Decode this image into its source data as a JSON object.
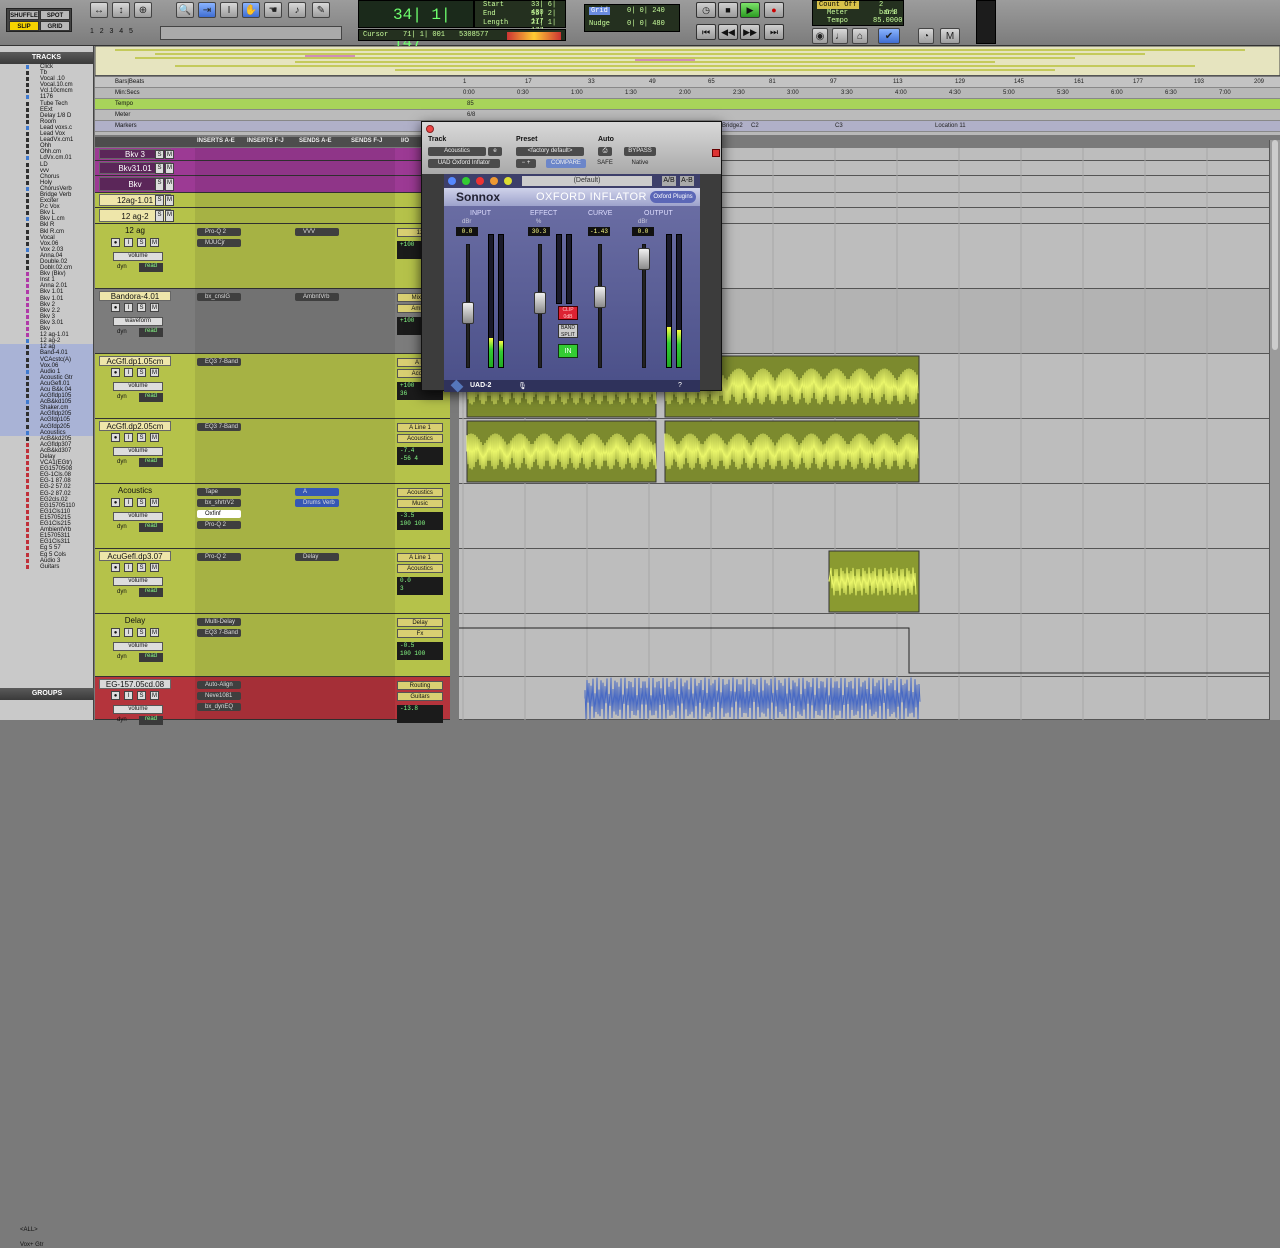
{
  "toolbar": {
    "modes": [
      "SHUFFLE",
      "SPOT",
      "SLIP",
      "GRID"
    ],
    "main_counter": "34| 1| 147",
    "start_label": "Start",
    "start_value": "33| 6| 430",
    "end_label": "End",
    "end_value": "55| 2| 177",
    "length_label": "Length",
    "length_value": "21| 1| 177",
    "cursor_label": "Cursor",
    "cursor_value": "71| 1| 001",
    "cursor_sample": "5308577",
    "grid_label": "Grid",
    "grid_value": "0| 0| 240",
    "nudge_label": "Nudge",
    "nudge_value": "0| 0| 480",
    "countoff_label": "Count Off",
    "countoff_value": "2 bars",
    "meter_label": "Meter",
    "meter_value": "6/8",
    "tempo_label": "Tempo",
    "tempo_value": "85.0000",
    "track_numbers": [
      "1",
      "2",
      "3",
      "4",
      "5"
    ]
  },
  "tracklist": {
    "title": "TRACKS",
    "items": [
      "Click",
      "Tb",
      "Vocal .10",
      "Vocal.10.cm",
      "Vcl.10cmcm",
      "1176",
      "Tube Tech",
      "EExt",
      "Delay 1/8 D",
      "Room",
      "Lead voxs.c",
      "Lead Vox",
      "LeadVx.cm1",
      "Ohh",
      "Ohh.cm",
      "LdVx.cm.01",
      "LD",
      "vvv",
      "Chorus",
      "Holy",
      "ChorusVerb",
      "Bridge Verb",
      "Exciter",
      "P.c Vox",
      "Bkv L",
      "Bkv L.cm",
      "Bkl R",
      "Bkl R.cm",
      "Vocal",
      "Vox.06",
      "Vox 2.03",
      "Anna.04",
      "Double.02",
      "Doblr.02.cm",
      "Bkv (Bkv)",
      "Inst 1",
      "Anna 2.01",
      "Bkv 1.01",
      "Bkv 1.01",
      "Bkv 2",
      "Bkv 2.2",
      "Bkv 3",
      "Bkv 3.01",
      "Bkv",
      "12 ag-1.01",
      "12 ag-2",
      "12 ag",
      "Band-4.01",
      "VCAcstc(A)",
      "Vox.06",
      "Audio 1",
      "Acoustic Gtr",
      "AcuGefl.01",
      "Acu B&k.04",
      "AcGfldp105",
      "AcB&kd105",
      "Shaker.cm",
      "AcGfldp205",
      "AcGfdp105",
      "AcGfdp205",
      "Acoustics",
      "AcB&kd205",
      "AcGfldp307",
      "AcB&kd307",
      "Delay",
      "VCA1(EGtr)",
      "EG1570508",
      "EG-1Cls.08",
      "EG-1 87.08",
      "EG-2 57.02",
      "EG-2 87.02",
      "EG2cls.02",
      "EG15705110",
      "EG1Cls110",
      "E15705215",
      "EG1Cls215",
      "AmbientVrb",
      "E15705311",
      "EG1Cls311",
      "Eg 5 57",
      "Eg 5 Cols",
      "Audio 3",
      "Guitars"
    ],
    "groups_title": "GROUPS",
    "groups": [
      "<ALL>",
      "Vox+ Gtr"
    ]
  },
  "rulers": {
    "bars_beats_label": "Bars|Beats",
    "min_secs_label": "Min:Secs",
    "tempo_label": "Tempo",
    "meter_label": "Meter",
    "markers_label": "Markers",
    "bars": [
      "1",
      "17",
      "33",
      "49",
      "65",
      "81",
      "97",
      "113",
      "129",
      "145",
      "161",
      "177",
      "193",
      "209"
    ],
    "times": [
      "0:00",
      "0:30",
      "1:00",
      "1:30",
      "2:00",
      "2:30",
      "3:00",
      "3:30",
      "4:00",
      "4:30",
      "5:00",
      "5:30",
      "6:00",
      "6:30",
      "7:00"
    ],
    "tempo_marker": "85",
    "meter_marker": "6/8",
    "markers": [
      "Bridge2",
      "C2",
      "C3",
      "Location 11"
    ]
  },
  "mixer_head": [
    "INSERTS A-E",
    "INSERTS F-J",
    "SENDS A-E",
    "SENDS F-J",
    "I/O"
  ],
  "tracks": [
    {
      "name": "Bkv 3",
      "color": "#b03aa8"
    },
    {
      "name": "Bkv31.01",
      "color": "#b03aa8"
    },
    {
      "name": "Bkv",
      "color": "#b03aa8"
    },
    {
      "name": "12ag-1.01",
      "color": "#b5c24a"
    },
    {
      "name": "12 ag-2",
      "color": "#b5c24a"
    },
    {
      "name": "12 ag",
      "color": "#b5c24a",
      "inserts": [
        "Pro-Q 2",
        "MJUCjr"
      ],
      "sends": [
        "VVV"
      ],
      "io": [
        "12"
      ],
      "vol": "+100"
    },
    {
      "name": "Bandora-4.01",
      "color": "#8a8a8a",
      "inserts": [
        "bx_cnslG"
      ],
      "sends": [
        "AmbntVrb"
      ],
      "io": [
        "MixA1",
        "Ambnt"
      ],
      "vol": "+100"
    },
    {
      "name": "AcGfl.dp1.05cm",
      "color": "#b5c24a",
      "inserts": [
        "EQ3 7-Band"
      ],
      "io": [
        "A Li",
        "Acous"
      ],
      "vol": "+100",
      "pan": "36"
    },
    {
      "name": "AcGfl.dp2.05cm",
      "color": "#b5c24a",
      "inserts": [
        "EQ3 7-Band"
      ],
      "io": [
        "A Line 1",
        "Acoustics"
      ],
      "vol": "-7.4",
      "pan": "-56 4"
    },
    {
      "name": "Acoustics",
      "color": "#b5c24a",
      "inserts": [
        "Tape",
        "bx_shrtrV2",
        "Oxfinf",
        "Pro-Q 2"
      ],
      "sends": [
        "A",
        "Drums Verb"
      ],
      "io": [
        "Acoustics",
        "Music"
      ],
      "vol": "-3.5",
      "pan": "100 100"
    },
    {
      "name": "AcuGefl.dp3.07",
      "color": "#b5c24a",
      "inserts": [
        "Pro-Q 2"
      ],
      "sends": [
        "Delay"
      ],
      "io": [
        "A Line 1",
        "Acoustics"
      ],
      "vol": "0.0",
      "pan": "3"
    },
    {
      "name": "Delay",
      "color": "#b5c24a",
      "inserts": [
        "Multi-Delay",
        "EQ3 7-Band"
      ],
      "io": [
        "Delay",
        "Fx"
      ],
      "vol": "-0.5",
      "pan": "100 100"
    },
    {
      "name": "EG-157.05cd.08",
      "color": "#c0303a",
      "inserts": [
        "Auto-Align",
        "Neve1081",
        "bx_dynEQ"
      ],
      "io": [
        "Routing",
        "Guitars"
      ],
      "vol": "-13.8"
    }
  ],
  "trackwidgets": {
    "volume_label": "volume",
    "waveform_label": "waveform",
    "dyn_label": "dyn",
    "read_label": "read"
  },
  "plugin": {
    "track_label": "Track",
    "preset_label": "Preset",
    "auto_label": "Auto",
    "track_name": "Acoustics",
    "track_slot": "e",
    "preset_name": "<factory default>",
    "plugin_name": "UAD Oxford Inflator",
    "compare_label": "COMPARE",
    "safe_label": "SAFE",
    "bypass_label": "BYPASS",
    "native_label": "Native",
    "default_preset": "(Default)",
    "brand": "Sonnox",
    "product": "OXFORD INFLATOR",
    "badge": "Oxford Plugins",
    "input_label": "INPUT",
    "input_unit": "dBr",
    "input_value": "0.0",
    "effect_label": "EFFECT",
    "effect_unit": "%",
    "effect_value": "30.3",
    "curve_label": "CURVE",
    "curve_value": "-1.43",
    "output_label": "OUTPUT",
    "output_unit": "dBr",
    "output_value": "0.0",
    "clip_label": "CLIP 0dB",
    "band_split_label": "BAND SPLIT",
    "in_label": "IN",
    "footer": "UAD-2",
    "ab_label": "A/B",
    "copy_label": "A-B"
  }
}
